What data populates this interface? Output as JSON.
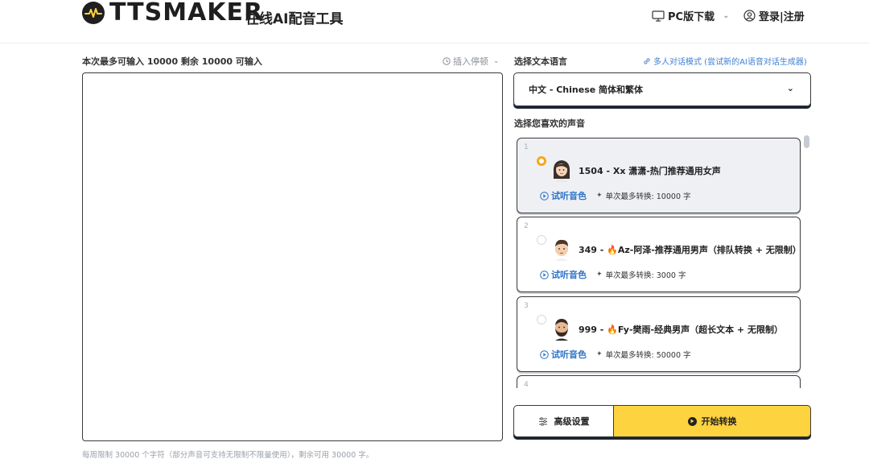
{
  "header": {
    "logo_text": "TTSMAKER",
    "tagline": "在线AI配音工具",
    "pc_download": "PC版下载",
    "login": "登录|注册"
  },
  "editor": {
    "limit_info": "本次最多可输入 10000 剩余 10000 可输入",
    "insert_pause": "插入停顿",
    "text_value": "",
    "footer_note": "每周限制 30000 个字符（部分声音可支持无限制不限量使用），剩余可用 30000 字。"
  },
  "language": {
    "label": "选择文本语言",
    "multi_link": "多人对话模式 (尝试新的AI语音对话生成器)",
    "selected": "中文 - Chinese 简体和繁体"
  },
  "voices": {
    "label": "选择您喜欢的声音",
    "items": [
      {
        "num": "1",
        "title": "1504 - Xx 潇潇-热门推荐通用女声",
        "listen": "试听音色",
        "max": "单次最多转换: 10000 字",
        "selected": true
      },
      {
        "num": "2",
        "title": "349 - 🔥Az-阿泽-推荐通用男声（排队转换 + 无限制）",
        "listen": "试听音色",
        "max": "单次最多转换: 3000 字",
        "selected": false
      },
      {
        "num": "3",
        "title": "999 - 🔥Fy-樊雨-经典男声（超长文本 + 无限制）",
        "listen": "试听音色",
        "max": "单次最多转换: 50000 字",
        "selected": false
      },
      {
        "num": "4"
      }
    ]
  },
  "buttons": {
    "advanced": "高级设置",
    "start": "开始转换"
  },
  "colors": {
    "accent_yellow": "#fdd33f",
    "link_blue": "#2f74c8",
    "radio_orange": "#f4a81d"
  }
}
